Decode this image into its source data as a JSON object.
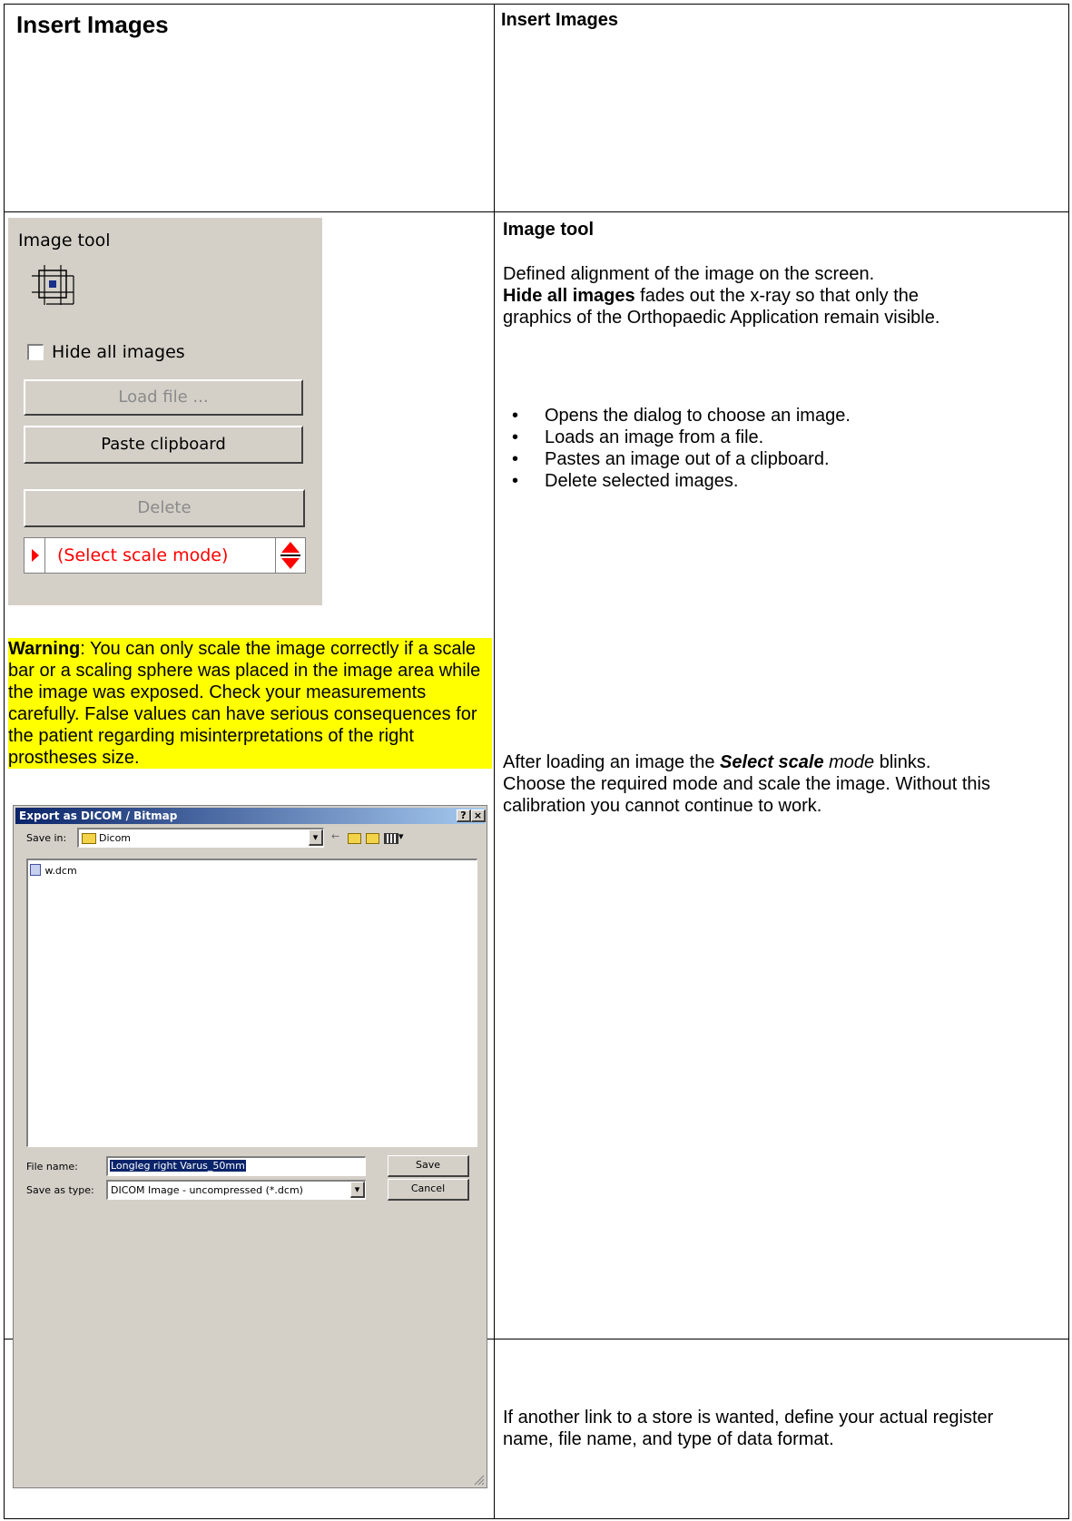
{
  "header": {
    "left_title": "Insert Images",
    "right_title": "Insert Images"
  },
  "panel": {
    "title": "Image tool",
    "hide_all_label": "Hide all images",
    "hide_all_checked": false,
    "load_file_label": "Load file ...",
    "paste_clipboard_label": "Paste clipboard",
    "delete_label": "Delete",
    "scale_mode_label": "(Select scale mode)"
  },
  "warning": {
    "bold": "Warning",
    "text": ": You can only scale the image correctly if a scale bar or a scaling sphere was placed in the image area while the image was exposed. Check your measurements carefully. False values can have serious consequences for the patient regarding misinterpretations of the right prostheses size."
  },
  "dialog": {
    "title": "Export as DICOM / Bitmap",
    "title_buttons": [
      "?",
      "×"
    ],
    "save_in_label": "Save in:",
    "save_in_value": "Dicom",
    "file_item": "w.dcm",
    "file_name_label": "File name:",
    "file_name_value": "Longleg right Varus_50mm",
    "save_type_label": "Save as type:",
    "save_type_value": "DICOM Image - uncompressed (*.dcm)",
    "save_button": "Save",
    "cancel_button": "Cancel"
  },
  "right": {
    "image_tool_heading": "Image tool",
    "intro": "Defined alignment of the image on the screen.",
    "hide_bold": "Hide all images",
    "hide_text": " fades out the x-ray so that only the graphics of the Orthopaedic Application remain visible.",
    "bullets": [
      "Opens the dialog to choose an image.",
      "Loads an image from a file.",
      "Pastes an image out of a clipboard.",
      "Delete selected images."
    ],
    "after_loading_1": "After loading an image the ",
    "after_loading_bold": "Select scale",
    "after_loading_italic": " mode",
    "after_loading_2": " blinks.",
    "choose_mode": "Choose the required mode and scale the image. Without this calibration you cannot continue to work.",
    "link_text": "If another link to a store is wanted, define your actual register name, file name, and type of data format."
  },
  "colors": {
    "warning_highlight": "#ffff00",
    "scale_mode_red": "#ff0000",
    "dialog_title_blue": "#0a246a"
  }
}
